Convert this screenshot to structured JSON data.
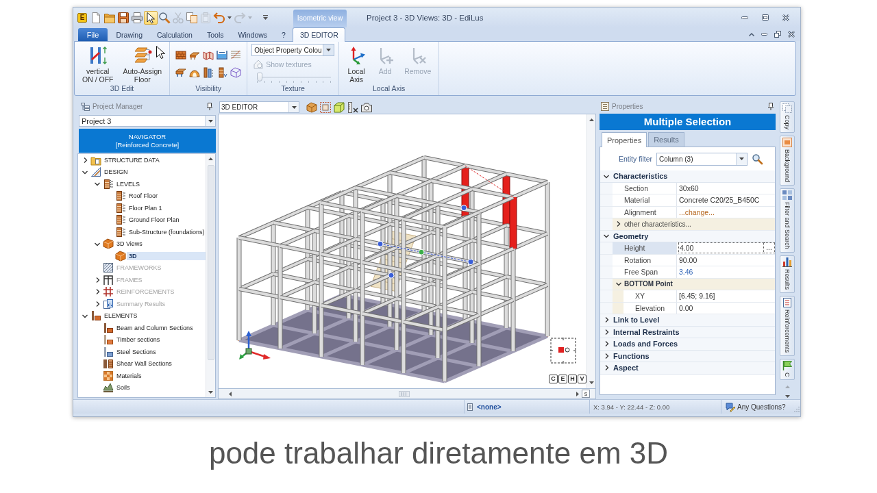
{
  "window": {
    "app_badge": "E",
    "title": "Project 3 - 3D Views: 3D - EdiLus",
    "context_group": "Isometric view"
  },
  "quick_access": [
    {
      "kind": "new",
      "selected": false,
      "disabled": false
    },
    {
      "kind": "open",
      "selected": false,
      "disabled": false
    },
    {
      "kind": "save",
      "selected": false,
      "disabled": false
    },
    {
      "kind": "print",
      "selected": false,
      "disabled": false
    },
    {
      "kind": "select",
      "selected": true,
      "disabled": false
    },
    {
      "kind": "zoom",
      "selected": false,
      "disabled": false
    },
    {
      "kind": "cut",
      "selected": false,
      "disabled": true
    },
    {
      "kind": "copy",
      "selected": false,
      "disabled": false
    },
    {
      "kind": "paste",
      "selected": false,
      "disabled": true
    },
    {
      "kind": "undo",
      "selected": false,
      "disabled": false
    },
    {
      "kind": "caret",
      "selected": false,
      "disabled": false
    },
    {
      "kind": "redo",
      "selected": false,
      "disabled": true
    },
    {
      "kind": "caret",
      "selected": false,
      "disabled": true
    },
    {
      "kind": "customize",
      "selected": false,
      "disabled": false
    }
  ],
  "ribbon": {
    "file_button": "File",
    "tabs": [
      {
        "label": "Drawing",
        "selected": false
      },
      {
        "label": "Calculation",
        "selected": false
      },
      {
        "label": "Tools",
        "selected": false
      },
      {
        "label": "Windows",
        "selected": false
      },
      {
        "label": "?",
        "selected": false
      },
      {
        "label": "3D EDITOR",
        "selected": true
      }
    ],
    "groups": [
      {
        "kind": "buttons",
        "title": "3D Edit",
        "buttons": [
          {
            "kind": "vertical",
            "label": "vertical\nON / OFF",
            "disabled": false
          },
          {
            "kind": "assign-floor",
            "label": "Auto-Assign\nFloor",
            "disabled": false
          }
        ]
      },
      {
        "kind": "icons",
        "title": "Visibility"
      },
      {
        "kind": "texture",
        "title": "Texture",
        "dropdown": "Object Property Colou",
        "toggle": {
          "label": "Show textures",
          "disabled": true
        },
        "slider": {
          "level": 0,
          "disabled": true
        }
      },
      {
        "kind": "buttons",
        "title": "Local Axis",
        "buttons": [
          {
            "kind": "axis",
            "label": "Local\nAxis",
            "disabled": false
          },
          {
            "kind": "axis-add",
            "label": "Add",
            "disabled": true
          },
          {
            "kind": "axis-remove",
            "label": "Remove",
            "disabled": true
          }
        ]
      }
    ]
  },
  "project_manager": {
    "title": "Project Manager",
    "project": "Project 3",
    "navigator": {
      "title": "NAVIGATOR",
      "subtitle": "[Reinforced Concrete]"
    },
    "tree": [
      {
        "label": "STRUCTURE DATA",
        "kind": "data",
        "expanded": false,
        "selected": false,
        "disabled": false
      },
      {
        "label": "DESIGN",
        "kind": "design",
        "expanded": true,
        "selected": false,
        "disabled": false,
        "children": [
          {
            "label": "LEVELS",
            "kind": "levels",
            "expanded": true,
            "selected": false,
            "disabled": false,
            "children": [
              {
                "label": "Roof Floor",
                "kind": "level",
                "selected": false,
                "disabled": false
              },
              {
                "label": "Floor Plan 1",
                "kind": "level",
                "selected": false,
                "disabled": false
              },
              {
                "label": "Ground Floor Plan",
                "kind": "level",
                "selected": false,
                "disabled": false
              },
              {
                "label": "Sub-Structure (foundations)",
                "kind": "level",
                "selected": false,
                "disabled": false
              }
            ]
          },
          {
            "label": "3D Views",
            "kind": "view3d",
            "expanded": true,
            "selected": false,
            "disabled": false,
            "children": [
              {
                "label": "3D",
                "kind": "view3d",
                "selected": true,
                "disabled": false
              }
            ]
          },
          {
            "label": "FRAMEWORKS",
            "kind": "frameworks",
            "selected": false,
            "disabled": true
          },
          {
            "label": "FRAMES",
            "kind": "frames",
            "expanded": false,
            "selected": false,
            "disabled": true
          },
          {
            "label": "REINFORCEMENTS",
            "kind": "reinforcements",
            "expanded": false,
            "selected": false,
            "disabled": true
          },
          {
            "label": "Summary Results",
            "kind": "results",
            "expanded": false,
            "selected": false,
            "disabled": true
          }
        ]
      },
      {
        "label": "ELEMENTS",
        "kind": "elements",
        "expanded": true,
        "selected": false,
        "disabled": false,
        "children": [
          {
            "label": "Beam and Column Sections",
            "kind": "sections",
            "selected": false,
            "disabled": false
          },
          {
            "label": "Timber sections",
            "kind": "timber",
            "selected": false,
            "disabled": false
          },
          {
            "label": "Steel Sections",
            "kind": "steel",
            "selected": false,
            "disabled": false
          },
          {
            "label": "Shear Wall Sections",
            "kind": "walls",
            "selected": false,
            "disabled": false
          },
          {
            "label": "Materials",
            "kind": "materials",
            "selected": false,
            "disabled": false
          },
          {
            "label": "Soils",
            "kind": "soils",
            "selected": false,
            "disabled": false
          }
        ]
      }
    ]
  },
  "viewport": {
    "mode": "3D EDITOR",
    "view_buttons": [
      "C",
      "E",
      "H",
      "V"
    ],
    "scroll_button": "s"
  },
  "properties": {
    "title": "Properties",
    "heading": "Multiple Selection",
    "tabs": [
      {
        "label": "Properties",
        "selected": true
      },
      {
        "label": "Results",
        "selected": false
      }
    ],
    "entity_filter": {
      "label": "Entity filter",
      "value": "Column (3)"
    },
    "groups": [
      {
        "label": "Characteristics",
        "expanded": true,
        "rows": [
          {
            "kind": "text",
            "label": "Section",
            "value": "30x60",
            "selected": false
          },
          {
            "kind": "text",
            "label": "Material",
            "value": "Concrete C20/25_B450C",
            "selected": false
          },
          {
            "kind": "link",
            "label": "Alignment",
            "value": "...change...",
            "selected": false
          },
          {
            "kind": "more",
            "label": "other characteristics...",
            "expanded": false,
            "selected": false
          }
        ]
      },
      {
        "label": "Geometry",
        "expanded": true,
        "rows": [
          {
            "kind": "text",
            "label": "Height",
            "value": "4.00",
            "selected": true,
            "button": "..."
          },
          {
            "kind": "text",
            "label": "Rotation",
            "value": "90.00",
            "selected": false
          },
          {
            "kind": "computed",
            "label": "Free Span",
            "value": "3.46",
            "selected": false
          },
          {
            "kind": "group",
            "label": "BOTTOM Point",
            "expanded": true,
            "selected": false,
            "rows": [
              {
                "kind": "text",
                "label": "XY",
                "value": "[6.45; 9.16]",
                "selected": false
              },
              {
                "kind": "text",
                "label": "Elevation",
                "value": "0.00",
                "selected": false
              }
            ]
          }
        ]
      },
      {
        "label": "Link to Level",
        "expanded": false
      },
      {
        "label": "Internal Restraints",
        "expanded": false
      },
      {
        "label": "Loads and Forces",
        "expanded": false
      },
      {
        "label": "Functions",
        "expanded": false
      },
      {
        "label": "Aspect",
        "expanded": false
      }
    ]
  },
  "side_tabs": [
    {
      "kind": "copy",
      "label": "Copy"
    },
    {
      "kind": "background",
      "label": "Background"
    },
    {
      "kind": "filter",
      "label": "Filter and Search"
    },
    {
      "kind": "results",
      "label": "Results"
    },
    {
      "kind": "reinforcements",
      "label": "Reinforcements"
    },
    {
      "kind": "other",
      "label": "C"
    }
  ],
  "status_bar": {
    "selection": "<none>",
    "coordinates": "X: 3.94 - Y: 22.44 - Z: 0.00",
    "help": "Any Questions?"
  },
  "caption": "pode trabalhar diretamente em 3D"
}
